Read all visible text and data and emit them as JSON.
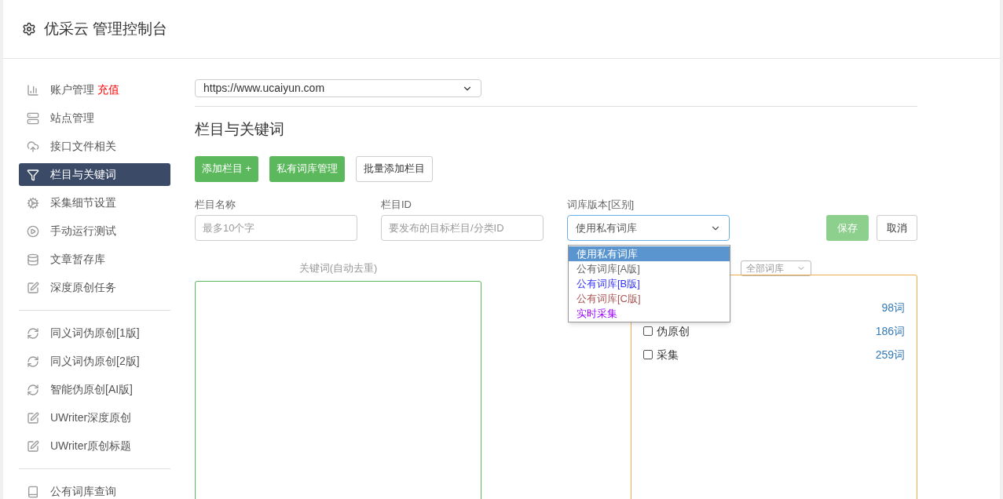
{
  "header": {
    "title": "优采云 管理控制台"
  },
  "sidebar": {
    "groups": [
      [
        {
          "label": "账户管理",
          "badge": "充值",
          "selected": false
        },
        {
          "label": "站点管理",
          "selected": false
        },
        {
          "label": "接口文件相关",
          "selected": false
        },
        {
          "label": "栏目与关键词",
          "selected": true
        },
        {
          "label": "采集细节设置",
          "selected": false
        },
        {
          "label": "手动运行测试",
          "selected": false
        },
        {
          "label": "文章暂存库",
          "selected": false
        },
        {
          "label": "深度原创任务",
          "selected": false
        }
      ],
      [
        {
          "label": "同义词伪原创[1版]",
          "selected": false
        },
        {
          "label": "同义词伪原创[2版]",
          "selected": false
        },
        {
          "label": "智能伪原创[AI版]",
          "selected": false
        },
        {
          "label": "UWriter深度原创",
          "selected": false
        },
        {
          "label": "UWriter原创标题",
          "selected": false
        }
      ],
      [
        {
          "label": "公有词库查询",
          "selected": false
        }
      ]
    ]
  },
  "site_select": {
    "value": "https://www.ucaiyun.com"
  },
  "section_title": "栏目与关键词",
  "buttons": [
    {
      "label": "添加栏目 +",
      "kind": "green"
    },
    {
      "label": "私有词库管理",
      "kind": "green"
    },
    {
      "label": "批量添加栏目",
      "kind": "plain"
    }
  ],
  "form": {
    "fields": [
      {
        "label": "栏目名称",
        "placeholder": "最多10个字",
        "kind": "input"
      },
      {
        "label": "栏目ID",
        "placeholder": "要发布的目标栏目/分类ID",
        "kind": "input"
      },
      {
        "label": "词库版本[区别]",
        "value": "使用私有词库",
        "kind": "select"
      }
    ],
    "save": {
      "label": "保存",
      "disabled": true
    },
    "cancel": {
      "label": "取消"
    }
  },
  "version_dropdown": {
    "options": [
      {
        "label": "使用私有词库",
        "selected": true
      },
      {
        "label": "公有词库[A版]",
        "selected": false,
        "color": "#666666"
      },
      {
        "label": "公有词库[B版]",
        "selected": false,
        "color": "#3333ff"
      },
      {
        "label": "公有词库[C版]",
        "selected": false,
        "color": "#aa5555"
      },
      {
        "label": "实时采集",
        "selected": false,
        "color": "#9900ff"
      }
    ]
  },
  "keywords": {
    "label": "关键词(自动去重)",
    "filter": "全部词库"
  },
  "libraries": [
    {
      "count": "98词"
    },
    {
      "label": "伪原创",
      "checked": false,
      "count": "186词"
    },
    {
      "label": "采集",
      "checked": false,
      "count": "259词"
    }
  ]
}
